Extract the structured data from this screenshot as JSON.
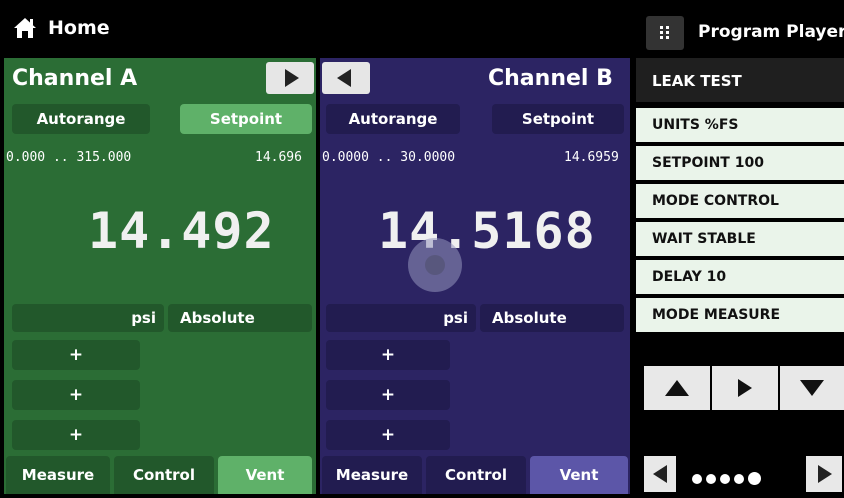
{
  "header": {
    "home_label": "Home",
    "program_player_label": "Program Player",
    "home_icon": "home-icon",
    "grid_icon": "grid-icon"
  },
  "channel_a": {
    "title": "Channel A",
    "color": "#2b6d35",
    "autorange_label": "Autorange",
    "setpoint_label": "Setpoint",
    "range": "0.000 .. 315.000",
    "setpoint_value": "14.696",
    "reading": "14.492",
    "unit": "psi",
    "mode": "Absolute",
    "plus_buttons": [
      "+",
      "+",
      "+"
    ],
    "tabs": [
      "Measure",
      "Control",
      "Vent"
    ],
    "active_tab": "Vent"
  },
  "channel_b": {
    "title": "Channel B",
    "color": "#2c2463",
    "autorange_label": "Autorange",
    "setpoint_label": "Setpoint",
    "range": "0.0000 .. 30.0000",
    "setpoint_value": "14.6959",
    "reading": "14.5168",
    "unit": "psi",
    "mode": "Absolute",
    "plus_buttons": [
      "+",
      "+",
      "+"
    ],
    "tabs": [
      "Measure",
      "Control",
      "Vent"
    ],
    "active_tab": "Vent"
  },
  "program": {
    "name": "LEAK TEST",
    "steps": [
      "UNITS %FS",
      "SETPOINT 100",
      "MODE CONTROL",
      "WAIT STABLE",
      "DELAY 10",
      "MODE MEASURE"
    ]
  },
  "pager": {
    "pages": 5,
    "current": 5
  }
}
